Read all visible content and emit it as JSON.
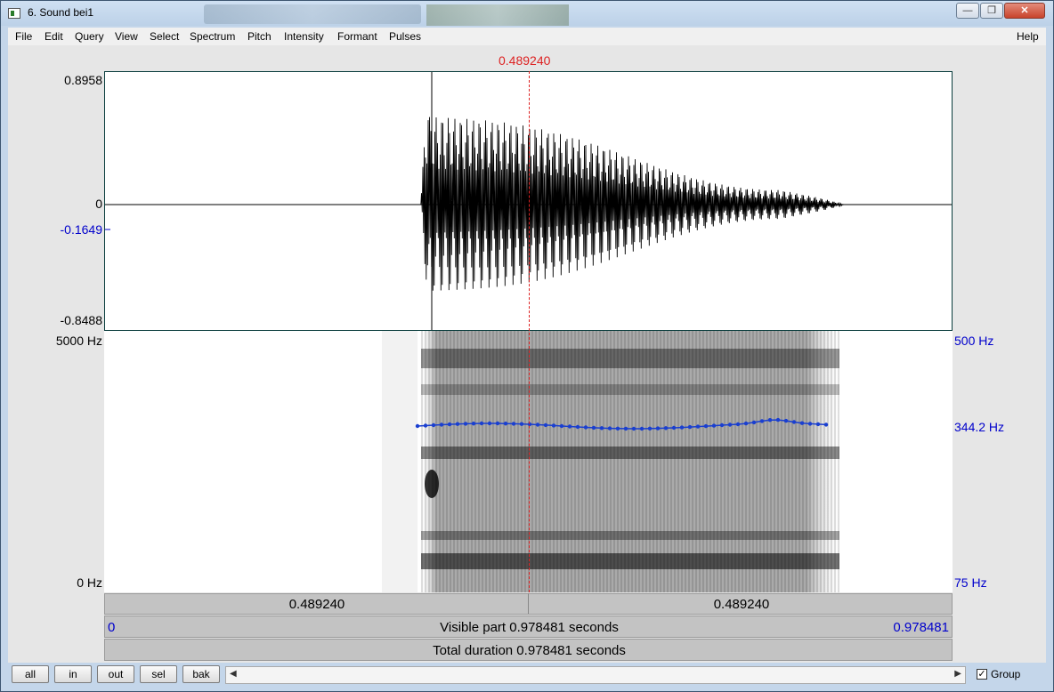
{
  "window": {
    "title": "6. Sound bei1",
    "minimize_label": "—",
    "maximize_label": "❐",
    "close_label": "✕"
  },
  "menu": {
    "items": [
      "File",
      "Edit",
      "Query",
      "View",
      "Select",
      "Spectrum",
      "Pitch",
      "Intensity",
      "Formant",
      "Pulses"
    ],
    "help": "Help"
  },
  "cursor_time": "0.489240",
  "waveform": {
    "y_max": "0.8958",
    "y_zero": "0",
    "y_cursor": "-0.1649",
    "y_min": "-0.8488"
  },
  "spectrogram": {
    "freq_max": "5000 Hz",
    "freq_min": "0 Hz",
    "pitch_max": "500 Hz",
    "pitch_cursor": "344.2 Hz",
    "pitch_min": "75 Hz"
  },
  "time_bars": {
    "left_segment": "0.489240",
    "right_segment": "0.489240",
    "visible_start": "0",
    "visible_label": "Visible part 0.978481 seconds",
    "visible_end": "0.978481",
    "total_label": "Total duration 0.978481 seconds"
  },
  "bottom_buttons": [
    "all",
    "in",
    "out",
    "sel",
    "bak"
  ],
  "group_checkbox": {
    "label": "Group",
    "checked": true,
    "mark": "✓"
  },
  "colors": {
    "cursor": "#dd2222",
    "pitch": "#1a3fd0",
    "axis_blue": "#0000cc"
  }
}
